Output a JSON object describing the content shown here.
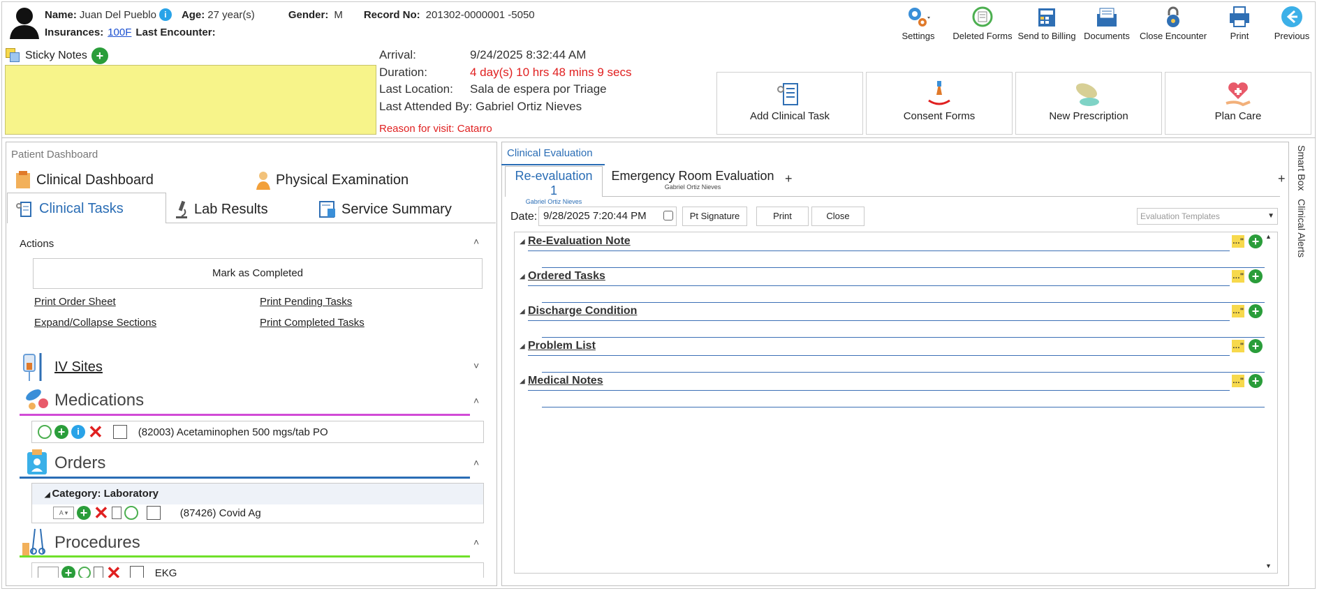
{
  "patient": {
    "name_label": "Name:",
    "name": "Juan Del Pueblo",
    "age_label": "Age:",
    "age": "27 year(s)",
    "gender_label": "Gender:",
    "gender": "M",
    "record_label": "Record No:",
    "record": "201302-0000001 -5050",
    "ins_label": "Insurances:",
    "ins": "100F",
    "last_enc_label": "Last Encounter:"
  },
  "toolbar": {
    "settings": "Settings",
    "deleted": "Deleted Forms",
    "billing": "Send to Billing",
    "documents": "Documents",
    "close": "Close Encounter",
    "print": "Print",
    "previous": "Previous"
  },
  "sticky": {
    "label": "Sticky Notes"
  },
  "visit": {
    "arrival_label": "Arrival:",
    "arrival": "9/24/2025 8:32:44 AM",
    "duration_label": "Duration:",
    "duration": "4 day(s) 10 hrs 48 mins 9 secs",
    "location_label": "Last Location:",
    "location": "Sala de espera por Triage",
    "attended": "Last Attended By: Gabriel Ortiz Nieves",
    "reason": "Reason for visit: Catarro"
  },
  "actions_big": {
    "add_task": "Add Clinical Task",
    "consent": "Consent Forms",
    "prescription": "New Prescription",
    "plan": "Plan Care"
  },
  "left": {
    "panel_title": "Patient Dashboard",
    "tab_dashboard": "Clinical Dashboard",
    "tab_physical": "Physical Examination",
    "tab_tasks": "Clinical Tasks",
    "tab_lab": "Lab Results",
    "tab_service": "Service Summary",
    "actions": "Actions",
    "mark_completed": "Mark as Completed",
    "print_order": "Print Order Sheet",
    "print_pending": "Print Pending Tasks",
    "expand": "Expand/Collapse Sections",
    "print_completed": "Print Completed Tasks",
    "iv_sites": "IV Sites",
    "medications": "Medications",
    "med_item": "(82003) Acetaminophen 500 mgs/tab PO",
    "orders": "Orders",
    "category": "Category: Laboratory",
    "order_item": "(87426) Covid Ag",
    "procedures": "Procedures",
    "proc_item": "EKG"
  },
  "right": {
    "panel_title": "Clinical Evaluation",
    "tab1": "Re-evaluation 1",
    "tab1_sub": "Gabriel Ortiz Nieves",
    "tab2": "Emergency Room Evaluation",
    "tab2_sub": "Gabriel Ortiz Nieves",
    "date_label": "Date:",
    "date": "9/28/2025 7:20:44 PM",
    "pt_signature": "Pt Signature",
    "print": "Print",
    "close": "Close",
    "templates": "Evaluation Templates",
    "sections": [
      "Re-Evaluation Note",
      "Ordered Tasks",
      "Discharge Condition",
      "Problem List",
      "Medical Notes"
    ]
  },
  "side": {
    "smart_box": "Smart Box",
    "clinical_alerts": "Clinical Alerts"
  },
  "colors": {
    "accent": "#2a6db5",
    "red": "#e02020",
    "sticky": "#f7f48a",
    "green": "#2a9d3a"
  }
}
